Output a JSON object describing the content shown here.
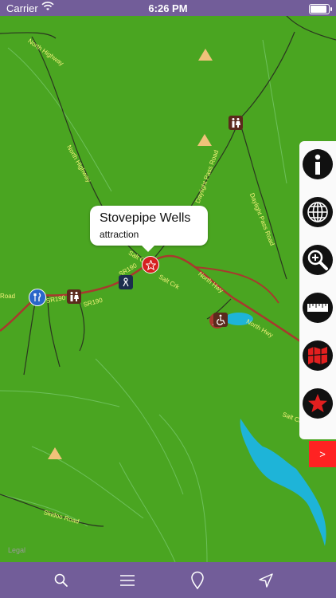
{
  "status_bar": {
    "carrier": "Carrier",
    "time": "6:26 PM"
  },
  "map": {
    "road_labels": [
      "North Highway",
      "North Highway",
      "Daylight Pass Road",
      "Daylight Pass Road",
      "North Hwy",
      "North Hwy",
      "SR190",
      "SR190",
      "SR190",
      "Salt Crk",
      "Salt Crk",
      "Salt Crk",
      "Skidoo Road",
      "Road"
    ],
    "callout": {
      "title": "Stovepipe Wells",
      "subtitle": "attraction"
    },
    "legal": "Legal"
  },
  "side_panel": {
    "buttons": [
      "info-icon",
      "globe-icon",
      "zoom-in-icon",
      "ruler-icon",
      "map-icon",
      "star-icon"
    ],
    "expand_label": ">"
  },
  "tab_bar": {
    "tabs": [
      "search-icon",
      "list-icon",
      "location-pin-icon",
      "navigation-arrow-icon"
    ]
  },
  "colors": {
    "accent": "#725d99",
    "map_green": "#4aa521",
    "water": "#1eb4d8",
    "expand_tab": "#ff2222"
  }
}
